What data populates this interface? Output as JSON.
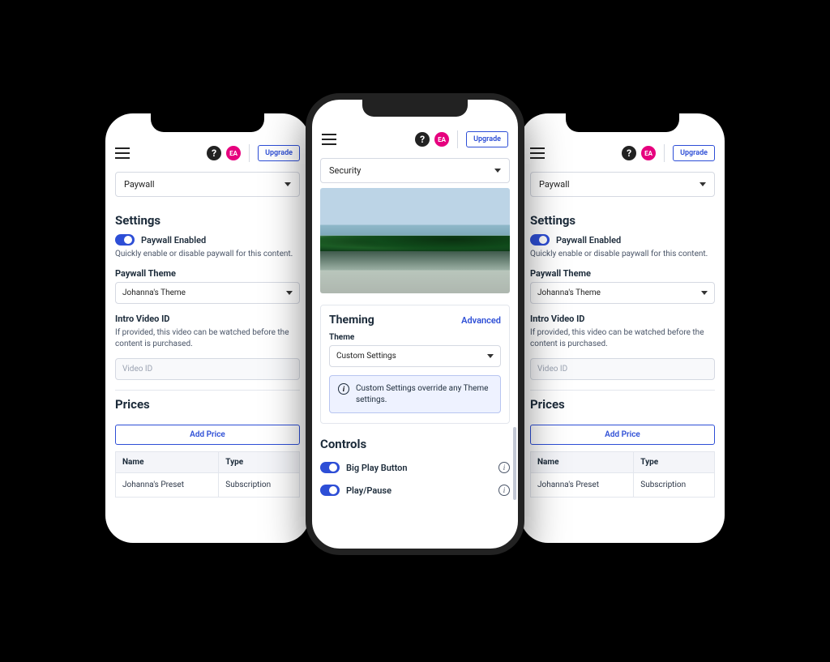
{
  "topbar": {
    "help_glyph": "?",
    "avatar_initials": "EA",
    "upgrade_label": "Upgrade"
  },
  "paywall": {
    "dropdown_label": "Paywall",
    "settings_title": "Settings",
    "toggle_label": "Paywall Enabled",
    "toggle_hint": "Quickly enable or disable paywall for this content.",
    "theme_label": "Paywall Theme",
    "theme_value": "Johanna's Theme",
    "intro_label": "Intro Video ID",
    "intro_hint": "If provided, this video can be watched before the content is purchased.",
    "intro_placeholder": "Video ID",
    "prices_title": "Prices",
    "add_price_label": "Add Price",
    "table": {
      "col_name": "Name",
      "col_type": "Type",
      "row1_name": "Johanna's Preset",
      "row1_type": "Subscription"
    }
  },
  "center": {
    "dropdown_label": "Security",
    "theming": {
      "title": "Theming",
      "advanced_link": "Advanced",
      "theme_label": "Theme",
      "theme_value": "Custom Settings",
      "info_text": "Custom Settings override any Theme settings."
    },
    "controls": {
      "title": "Controls",
      "items": [
        {
          "label": "Big Play Button"
        },
        {
          "label": "Play/Pause"
        }
      ]
    }
  }
}
